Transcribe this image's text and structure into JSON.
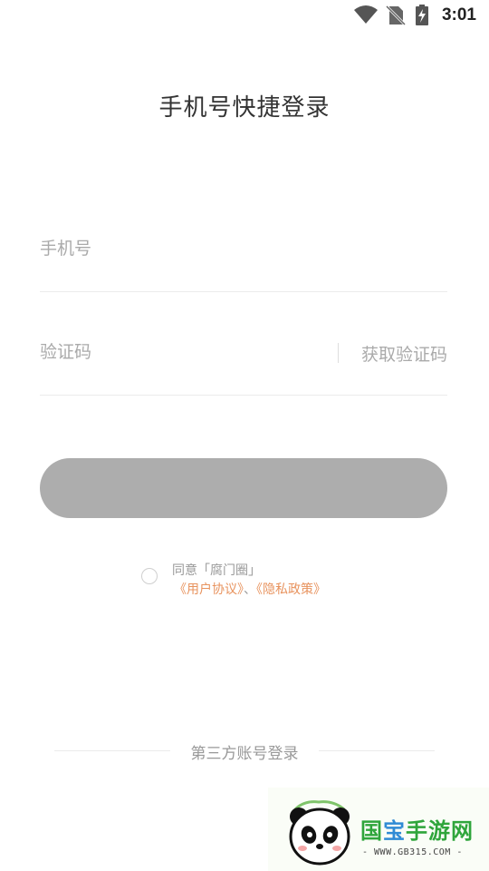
{
  "status_bar": {
    "time": "3:01"
  },
  "page": {
    "title": "手机号快捷登录"
  },
  "form": {
    "phone_placeholder": "手机号",
    "code_placeholder": "验证码",
    "get_code_label": "获取验证码",
    "submit_label": ""
  },
  "agreement": {
    "prefix": "同意「腐门圈」",
    "user_agreement": "《用户协议》",
    "separator": "、",
    "privacy_policy": "《隐私政策》"
  },
  "third_party": {
    "label": "第三方账号登录"
  },
  "watermark": {
    "title_part1": "国",
    "title_part2": "宝",
    "title_part3": "手游网",
    "url": "- WWW.GB315.COM -"
  },
  "colors": {
    "button_disabled": "#adadad",
    "link": "#e8935e",
    "placeholder": "#aaaaaa",
    "watermark_green": "#2fa53b",
    "watermark_blue": "#2f8bd5"
  },
  "icons": [
    "wifi-icon",
    "no-sim-icon",
    "battery-charging-icon",
    "panda-logo-icon"
  ]
}
